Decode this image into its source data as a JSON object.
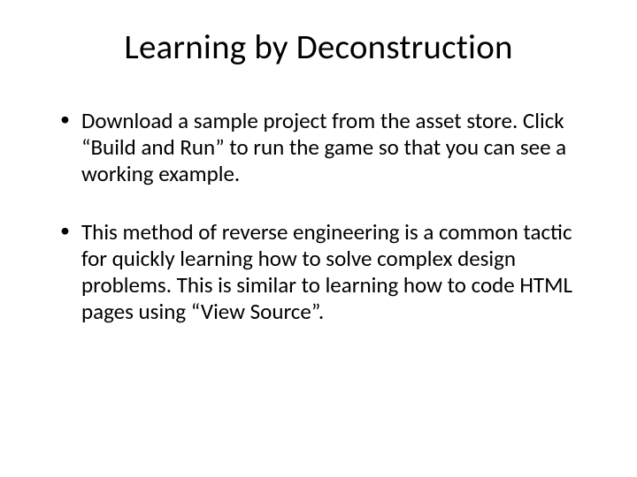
{
  "slide": {
    "title": "Learning by Deconstruction",
    "bullets": [
      "Download a sample project from the asset store.  Click “Build and Run” to run the game so that you can see a working example.",
      "This method of reverse engineering is a common tactic for quickly learning how to solve complex design problems.  This is similar to learning how to code HTML pages using “View Source”."
    ]
  }
}
